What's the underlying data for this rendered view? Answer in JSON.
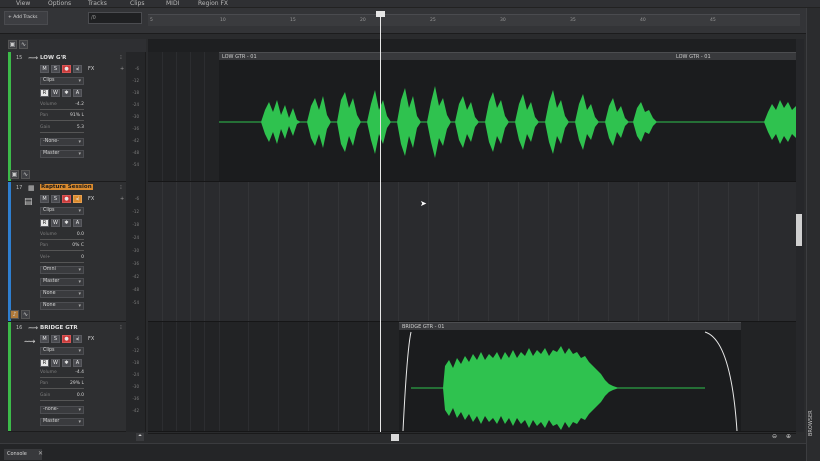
{
  "menu": {
    "items": [
      "View",
      "Options",
      "Tracks",
      "Clips",
      "MIDI",
      "Region FX"
    ]
  },
  "toolbar": {
    "add_tracks_label": "+ Add Tracks",
    "track_search_value": "/0"
  },
  "timeline": {
    "ticks": [
      "5",
      "10",
      "15",
      "20",
      "25",
      "30",
      "35",
      "40",
      "45"
    ]
  },
  "right_panel": {
    "browser_label": "BROWSER"
  },
  "tracks": [
    {
      "number": "15",
      "name": "LOW G'R",
      "color": "#3dbb4a",
      "fx_label": "FX",
      "clips_label": "Clips",
      "volume_label": "Volume",
      "volume_value": "-4.2",
      "pan_label": "Pan",
      "pan_value": "91% L",
      "gain_label": "Gain",
      "gain_value": "5.3",
      "input_value": "-None-",
      "output_value": "Master",
      "meter_ticks": [
        "-6",
        "-12",
        "-18",
        "-24",
        "-30",
        "-36",
        "-42",
        "-48",
        "-54"
      ]
    },
    {
      "number": "17",
      "name": "Rapture Session",
      "color": "#2f7fcf",
      "fx_label": "FX",
      "clips_label": "Clips",
      "volume_label": "Volume",
      "volume_value": "0.0",
      "pan_label": "Pan",
      "pan_value": "0% C",
      "gain_label": "Vel+",
      "gain_value": "0",
      "input_value": "Omni",
      "output_value": "Master",
      "extra_dropdowns": [
        "None",
        "None"
      ],
      "meter_ticks": [
        "-6",
        "-12",
        "-18",
        "-24",
        "-30",
        "-36",
        "-42",
        "-48",
        "-54"
      ]
    },
    {
      "number": "16",
      "name": "BRIDGE GTR",
      "color": "#3dbb4a",
      "fx_label": "FX",
      "clips_label": "Clips",
      "volume_label": "Volume",
      "volume_value": "-4.4",
      "pan_label": "Pan",
      "pan_value": "29% L",
      "gain_label": "Gain",
      "gain_value": "0.0",
      "input_value": "-none-",
      "output_value": "Master",
      "meter_ticks": [
        "-6",
        "-12",
        "-18",
        "-24",
        "-30",
        "-36",
        "-42"
      ]
    }
  ],
  "clips": [
    {
      "name": "LOW GTR - 01"
    },
    {
      "name": "LOW GTR - 01"
    },
    {
      "name": "BRIDGE GTR - 01"
    }
  ],
  "bottom": {
    "console_tab": "Console"
  },
  "colors": {
    "waveform": "#2fc24f",
    "accent_orange": "#d98a2e",
    "record_red": "#c93a3a"
  }
}
